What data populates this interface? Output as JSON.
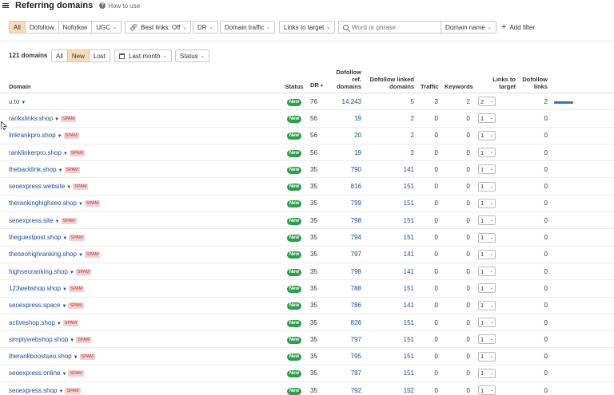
{
  "header": {
    "title": "Referring domains",
    "help_label": "How to use"
  },
  "filters": {
    "type_segments": [
      "All",
      "Dofollow",
      "Nofollow",
      "UGC"
    ],
    "best_links": "Best links: Off",
    "dr": "DR",
    "domain_traffic": "Domain traffic",
    "links_to_target": "Links to target",
    "search_placeholder": "Word or phrase",
    "search_scope": "Domain name",
    "add_filter": "Add filter"
  },
  "summary": {
    "count": "121 domains",
    "new_segments": [
      "All",
      "New",
      "Lost"
    ],
    "period": "Last month",
    "status": "Status"
  },
  "colors": {
    "accent_active": "#fbdcb8",
    "new_badge": "#2e9e4c",
    "spam_tag": "#f6d0cf",
    "link": "#1a4b9c",
    "bar": "#2a78c9"
  },
  "table": {
    "headers": {
      "domain": "Domain",
      "status": "Status",
      "dr": "DR",
      "dofollow_ref_domains": "Dofollow ref. domains",
      "dofollow_linked_domains": "Dofollow linked domains",
      "traffic": "Traffic",
      "keywords": "Keywords",
      "links_to_target": "Links to target",
      "dofollow_links": "Dofollow links"
    },
    "rows": [
      {
        "domain": "u.to",
        "spam": "",
        "status": "New",
        "dr": "76",
        "ref": "14,243",
        "linked": "5",
        "traffic": "3",
        "keywords": "2",
        "ltt": "2",
        "dofollow": "2",
        "bar_fraction": 1.0
      },
      {
        "domain": "rankxlinks.shop",
        "spam": "SPAM",
        "status": "New",
        "dr": "56",
        "ref": "19",
        "linked": "2",
        "traffic": "0",
        "keywords": "0",
        "ltt": "1",
        "dofollow": "0",
        "bar_fraction": 0
      },
      {
        "domain": "linkrankpro.shop",
        "spam": "SPAM",
        "status": "New",
        "dr": "56",
        "ref": "20",
        "linked": "2",
        "traffic": "0",
        "keywords": "0",
        "ltt": "1",
        "dofollow": "0",
        "bar_fraction": 0
      },
      {
        "domain": "ranklinkerpro.shop",
        "spam": "SPAM",
        "status": "New",
        "dr": "56",
        "ref": "19",
        "linked": "2",
        "traffic": "0",
        "keywords": "0",
        "ltt": "1",
        "dofollow": "0",
        "bar_fraction": 0
      },
      {
        "domain": "thebacklink.shop",
        "spam": "SPAM",
        "status": "New",
        "dr": "35",
        "ref": "790",
        "linked": "141",
        "traffic": "0",
        "keywords": "0",
        "ltt": "1",
        "dofollow": "0",
        "bar_fraction": 0
      },
      {
        "domain": "seoexpress.website",
        "spam": "SPAM",
        "status": "New",
        "dr": "35",
        "ref": "816",
        "linked": "151",
        "traffic": "0",
        "keywords": "0",
        "ltt": "1",
        "dofollow": "0",
        "bar_fraction": 0
      },
      {
        "domain": "therankinghighseo.shop",
        "spam": "SPAM",
        "status": "New",
        "dr": "35",
        "ref": "799",
        "linked": "151",
        "traffic": "0",
        "keywords": "0",
        "ltt": "1",
        "dofollow": "0",
        "bar_fraction": 0
      },
      {
        "domain": "seoexpress.site",
        "spam": "SPAM",
        "status": "New",
        "dr": "35",
        "ref": "798",
        "linked": "151",
        "traffic": "0",
        "keywords": "0",
        "ltt": "1",
        "dofollow": "0",
        "bar_fraction": 0
      },
      {
        "domain": "theguestpost.shop",
        "spam": "SPAM",
        "status": "New",
        "dr": "35",
        "ref": "794",
        "linked": "151",
        "traffic": "0",
        "keywords": "0",
        "ltt": "1",
        "dofollow": "0",
        "bar_fraction": 0
      },
      {
        "domain": "theseohighranking.shop",
        "spam": "SPAM",
        "status": "New",
        "dr": "35",
        "ref": "797",
        "linked": "141",
        "traffic": "0",
        "keywords": "0",
        "ltt": "1",
        "dofollow": "0",
        "bar_fraction": 0
      },
      {
        "domain": "highseoranking.shop",
        "spam": "SPAM",
        "status": "New",
        "dr": "35",
        "ref": "798",
        "linked": "141",
        "traffic": "0",
        "keywords": "0",
        "ltt": "1",
        "dofollow": "0",
        "bar_fraction": 0
      },
      {
        "domain": "123webshop.shop",
        "spam": "SPAM",
        "status": "New",
        "dr": "35",
        "ref": "788",
        "linked": "151",
        "traffic": "0",
        "keywords": "0",
        "ltt": "1",
        "dofollow": "0",
        "bar_fraction": 0
      },
      {
        "domain": "seoexpress.space",
        "spam": "SPAM",
        "status": "New",
        "dr": "35",
        "ref": "786",
        "linked": "141",
        "traffic": "0",
        "keywords": "0",
        "ltt": "1",
        "dofollow": "0",
        "bar_fraction": 0
      },
      {
        "domain": "activeshop.shop",
        "spam": "SPAM",
        "status": "New",
        "dr": "35",
        "ref": "826",
        "linked": "151",
        "traffic": "0",
        "keywords": "0",
        "ltt": "1",
        "dofollow": "0",
        "bar_fraction": 0
      },
      {
        "domain": "simplywebshop.shop",
        "spam": "SPAM",
        "status": "New",
        "dr": "35",
        "ref": "797",
        "linked": "151",
        "traffic": "0",
        "keywords": "0",
        "ltt": "1",
        "dofollow": "0",
        "bar_fraction": 0
      },
      {
        "domain": "therankboostseo.shop",
        "spam": "SPAM",
        "status": "New",
        "dr": "35",
        "ref": "795",
        "linked": "151",
        "traffic": "0",
        "keywords": "0",
        "ltt": "1",
        "dofollow": "0",
        "bar_fraction": 0
      },
      {
        "domain": "seoexpress.online",
        "spam": "SPAM",
        "status": "New",
        "dr": "35",
        "ref": "797",
        "linked": "151",
        "traffic": "0",
        "keywords": "0",
        "ltt": "1",
        "dofollow": "0",
        "bar_fraction": 0
      },
      {
        "domain": "seoexpress.shop",
        "spam": "SPAM",
        "status": "New",
        "dr": "35",
        "ref": "792",
        "linked": "152",
        "traffic": "0",
        "keywords": "0",
        "ltt": "1",
        "dofollow": "0",
        "bar_fraction": 0
      }
    ]
  }
}
